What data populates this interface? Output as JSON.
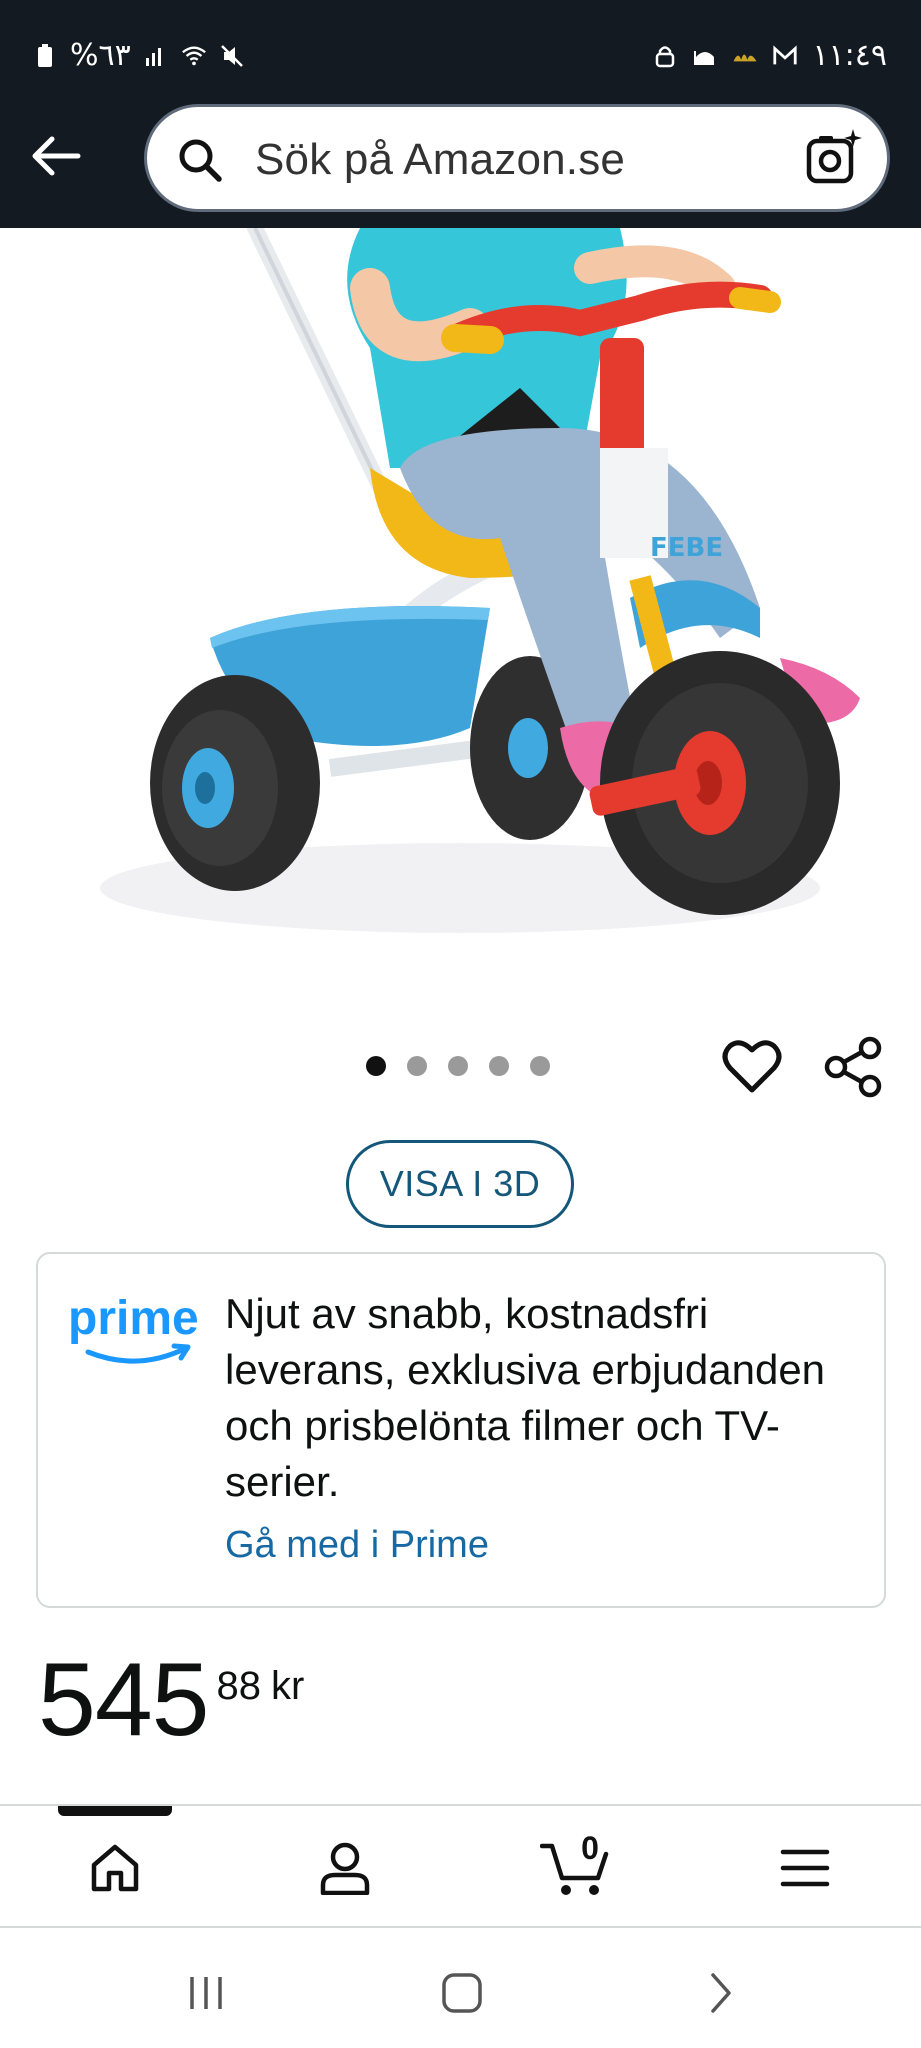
{
  "status_bar": {
    "left_text": "%٦٣",
    "time": "١١:٤٩"
  },
  "search": {
    "placeholder": "Sök på Amazon.se"
  },
  "gallery": {
    "dots_total": 5,
    "active_index": 0,
    "brand_text_on_image": "FEBE"
  },
  "buttons": {
    "view_3d": "VISA I 3D"
  },
  "prime": {
    "logo_word": "prime",
    "text": "Njut av snabb, kostnadsfri leverans, exklusiva erbjudanden och prisbelönta filmer och TV-serier.",
    "link": "Gå med i Prime"
  },
  "price": {
    "whole": "545",
    "fraction": "88",
    "currency": "kr"
  },
  "bottom_nav": {
    "items": [
      "home-icon",
      "account-icon",
      "cart-icon",
      "menu-icon"
    ],
    "cart_count": "0",
    "active_index": 0
  },
  "colors": {
    "header_bg": "#131a22",
    "link_blue": "#1769a3",
    "view3d_border": "#14577a",
    "prime_blue": "#1a98ff"
  }
}
